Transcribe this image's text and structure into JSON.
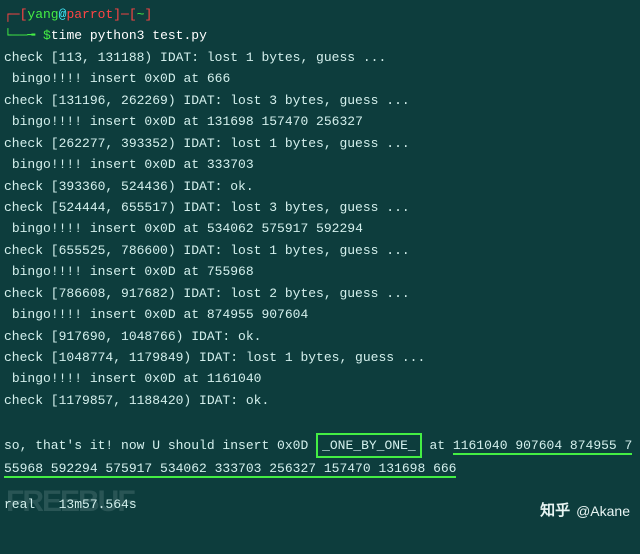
{
  "prompt": {
    "open_bracket": "┌─[",
    "user": "yang",
    "at": "@",
    "host": "parrot",
    "close_bracket": "]─[",
    "path": "~",
    "end_bracket": "]",
    "arrow": "└──╼",
    "dollar": "$",
    "command": "time python3 test.py"
  },
  "lines": [
    "check [113, 131188) IDAT: lost 1 bytes, guess ...",
    " bingo!!!! insert 0x0D at 666",
    "check [131196, 262269) IDAT: lost 3 bytes, guess ...",
    " bingo!!!! insert 0x0D at 131698 157470 256327",
    "check [262277, 393352) IDAT: lost 1 bytes, guess ...",
    " bingo!!!! insert 0x0D at 333703",
    "check [393360, 524436) IDAT: ok.",
    "check [524444, 655517) IDAT: lost 3 bytes, guess ...",
    " bingo!!!! insert 0x0D at 534062 575917 592294",
    "check [655525, 786600) IDAT: lost 1 bytes, guess ...",
    " bingo!!!! insert 0x0D at 755968",
    "check [786608, 917682) IDAT: lost 2 bytes, guess ...",
    " bingo!!!! insert 0x0D at 874955 907604",
    "check [917690, 1048766) IDAT: ok.",
    "check [1048774, 1179849) IDAT: lost 1 bytes, guess ...",
    " bingo!!!! insert 0x0D at 1161040",
    "check [1179857, 1188420) IDAT: ok.",
    ""
  ],
  "final": {
    "prefix": "so, that's it! now U should insert 0x0D ",
    "boxed": "_ONE_BY_ONE_",
    "mid": " at ",
    "numbers": "1161040 907604 874955 755968 592294 575917 534062 333703 256327 157470 131698 666"
  },
  "timing": {
    "label": "real",
    "value": "   13m57.564s"
  },
  "watermark": {
    "bg": "FREEBUF",
    "zhihu_label": "知乎",
    "author": "@Akane"
  }
}
